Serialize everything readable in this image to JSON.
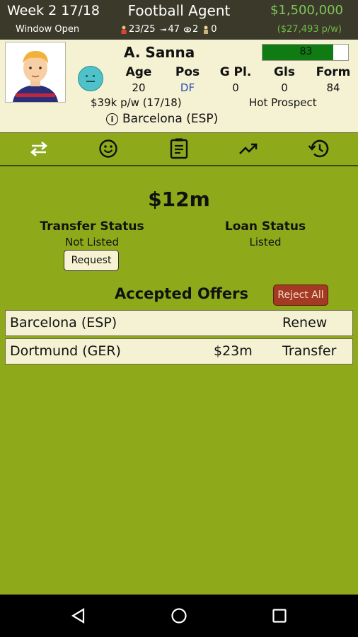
{
  "topbar": {
    "week": "Week 2 17/18",
    "app_title": "Football Agent",
    "balance": "$1,500,000",
    "window": "Window Open",
    "stat_clients": "23/25",
    "stat_scouts": "47",
    "stat_views": "2",
    "stat_trophies": "0",
    "income": "($27,493 p/w)",
    "money_color": "#7fc657"
  },
  "player": {
    "name": "A. Sanna",
    "rating": "83",
    "rating_fraction": 0.83,
    "headers": [
      "Age",
      "Pos",
      "G Pl.",
      "Gls",
      "Form"
    ],
    "values": [
      "20",
      "DF",
      "0",
      "0",
      "84"
    ],
    "wage": "$39k p/w (17/18)",
    "status_tag": "Hot Prospect",
    "club": "Barcelona (ESP)",
    "mood_icon": "neutral-face-icon"
  },
  "tabs": [
    {
      "name": "transfer-tab",
      "icon": "swap-arrows-icon"
    },
    {
      "name": "mood-tab",
      "icon": "smiley-icon"
    },
    {
      "name": "contract-tab",
      "icon": "document-icon"
    },
    {
      "name": "stats-tab",
      "icon": "trending-up-icon"
    },
    {
      "name": "history-tab",
      "icon": "history-icon"
    }
  ],
  "main": {
    "value": "$12m",
    "transfer_status_label": "Transfer Status",
    "transfer_status_value": "Not Listed",
    "request_label": "Request",
    "loan_status_label": "Loan Status",
    "loan_status_value": "Listed",
    "accepted_offers_label": "Accepted Offers",
    "reject_all_label": "Reject All",
    "offers": [
      {
        "club": "Barcelona (ESP)",
        "fee": "",
        "type": "Renew"
      },
      {
        "club": "Dortmund (GER)",
        "fee": "$23m",
        "type": "Transfer"
      }
    ]
  },
  "colors": {
    "background_green": "#8eaa1a",
    "header_dark": "#3b3a2a",
    "card_cream": "#f4f2d3",
    "reject_red": "#a43a23"
  }
}
